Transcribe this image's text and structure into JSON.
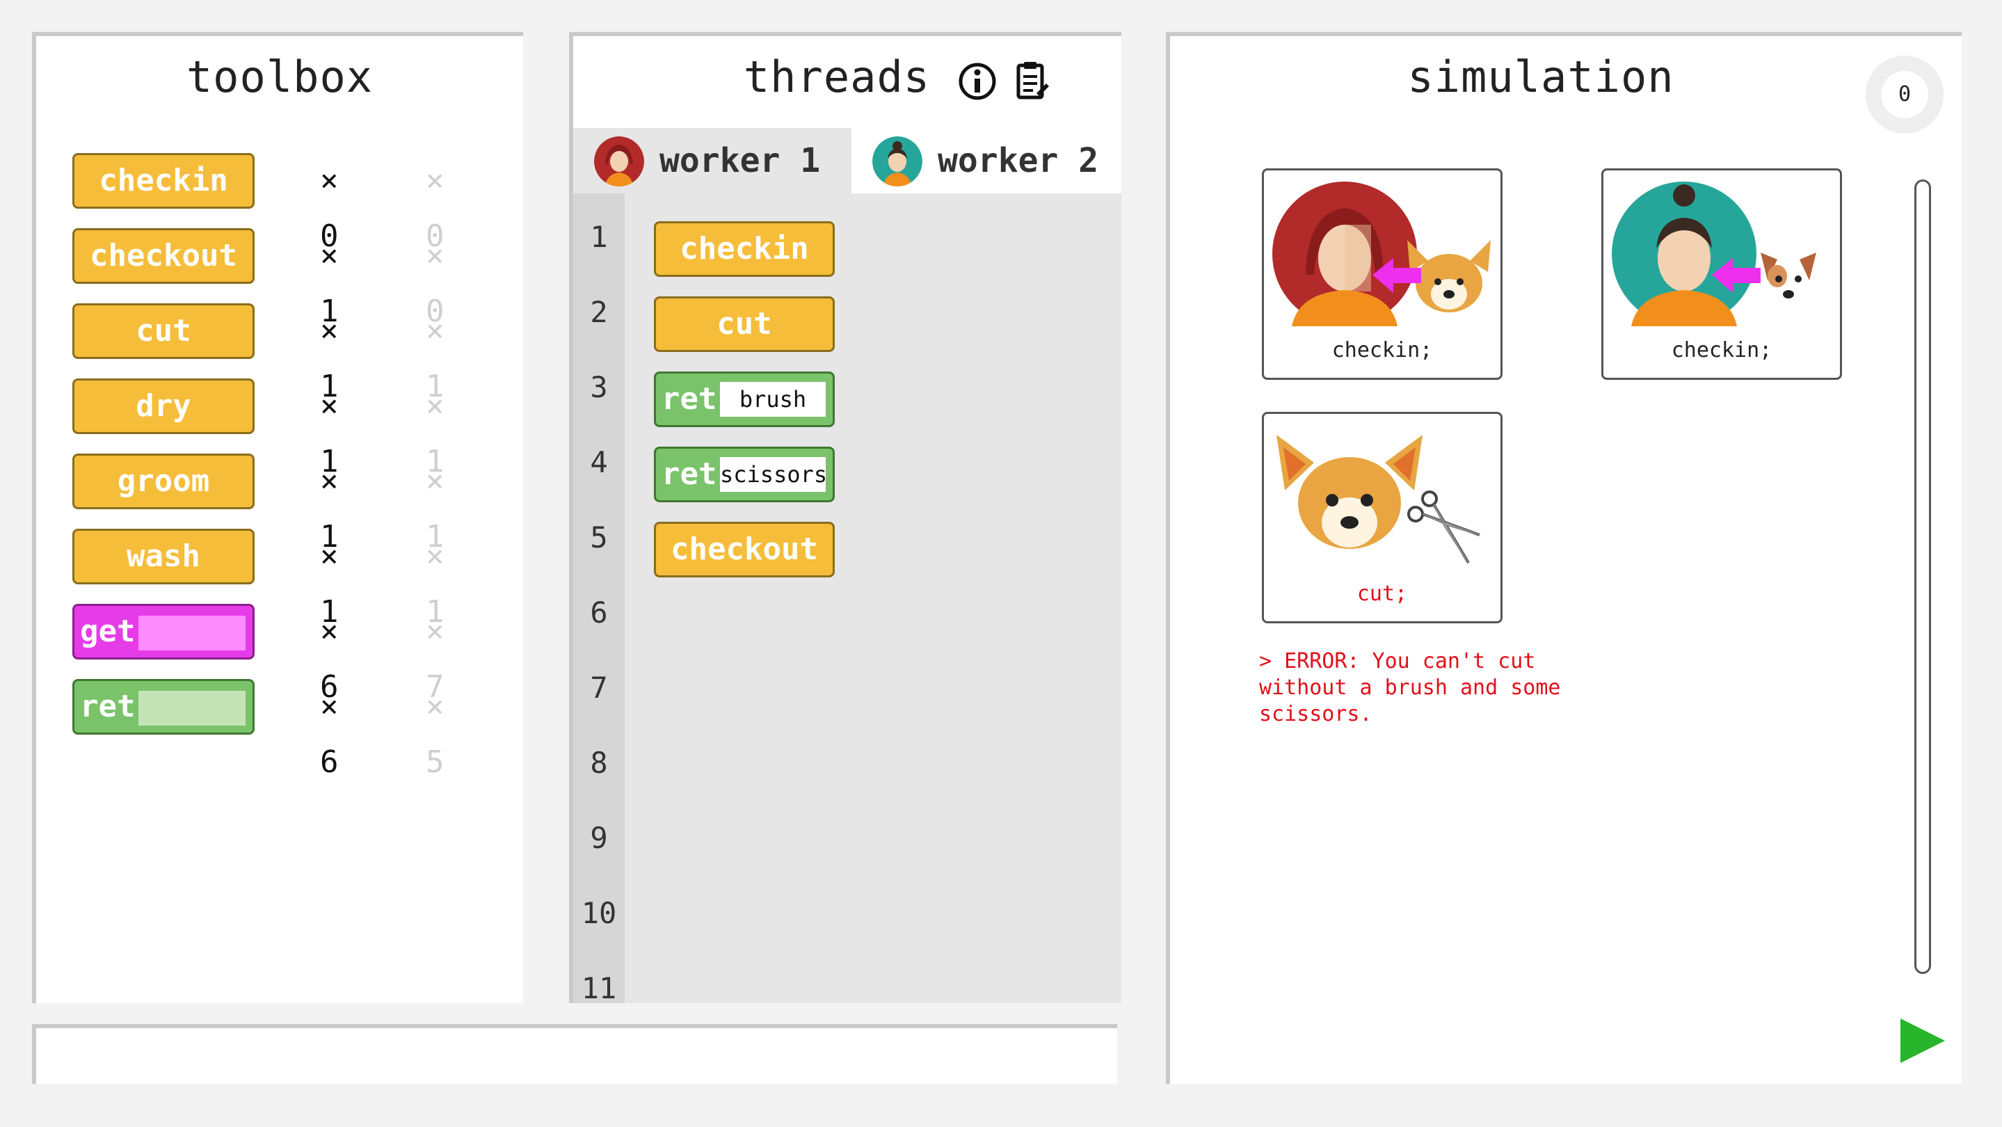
{
  "toolbox": {
    "title": "toolbox",
    "items": [
      {
        "label": "checkin",
        "count": "× 0",
        "max": "× 0",
        "kind": "op"
      },
      {
        "label": "checkout",
        "count": "× 1",
        "max": "× 0",
        "kind": "op"
      },
      {
        "label": "cut",
        "count": "× 1",
        "max": "× 1",
        "kind": "op"
      },
      {
        "label": "dry",
        "count": "× 1",
        "max": "× 1",
        "kind": "op"
      },
      {
        "label": "groom",
        "count": "× 1",
        "max": "× 1",
        "kind": "op"
      },
      {
        "label": "wash",
        "count": "× 1",
        "max": "× 1",
        "kind": "op"
      },
      {
        "label": "get",
        "count": "× 6",
        "max": "× 7",
        "kind": "get"
      },
      {
        "label": "ret",
        "count": "× 6",
        "max": "× 5",
        "kind": "ret"
      }
    ]
  },
  "threads": {
    "title": "threads",
    "info_icon": "info-icon",
    "clipboard_icon": "clipboard-icon",
    "tabs": [
      {
        "label": "worker 1",
        "active": true,
        "avatar": "worker-red"
      },
      {
        "label": "worker 2",
        "active": false,
        "avatar": "worker-teal"
      }
    ],
    "line_numbers": [
      "1",
      "2",
      "3",
      "4",
      "5",
      "6",
      "7",
      "8",
      "9",
      "10",
      "11"
    ],
    "code": [
      {
        "label": "checkin",
        "kind": "op"
      },
      {
        "label": "cut",
        "kind": "op"
      },
      {
        "label": "ret",
        "kind": "ret",
        "arg": "brush"
      },
      {
        "label": "ret",
        "kind": "ret",
        "arg": "scissors"
      },
      {
        "label": "checkout",
        "kind": "op"
      }
    ]
  },
  "simulation": {
    "title": "simulation",
    "step": "0",
    "cards": [
      {
        "caption": "checkin;",
        "error": false
      },
      {
        "caption": "checkin;",
        "error": false
      },
      {
        "caption": "cut;",
        "error": true
      }
    ],
    "error_message": "> ERROR: You can't cut\nwithout a brush and some\nscissors."
  },
  "colors": {
    "op_block": "#f5bd3a",
    "get_block": "#e63ce8",
    "ret_block": "#7ac36a",
    "error": "#e0101a",
    "play": "#27b52b"
  }
}
